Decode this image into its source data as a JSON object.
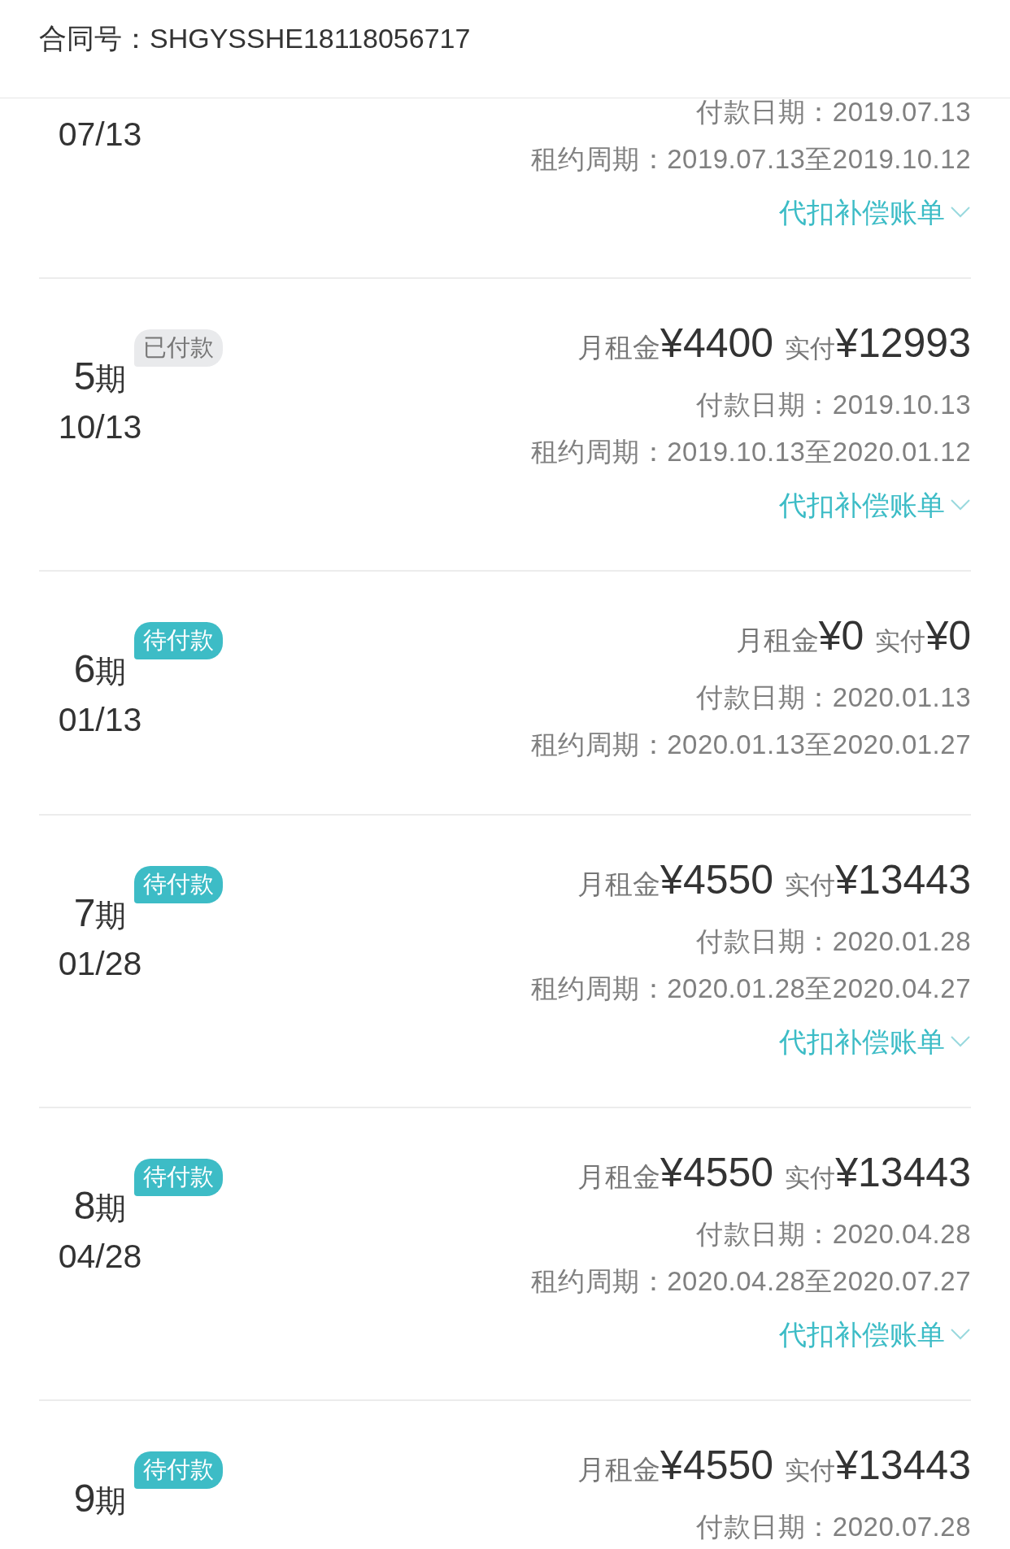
{
  "header": {
    "contract_label": "合同号：",
    "contract_no": "SHGYSSHE18118056717"
  },
  "installments": [
    {
      "date": "07/13",
      "pay_date": "付款日期：2019.07.13",
      "lease_period": "租约周期：2019.07.13至2019.10.12",
      "link": {
        "label": "代扣补偿账单",
        "expanded": false
      }
    },
    {
      "number": "5",
      "unit": "期",
      "status": {
        "label": "已付款",
        "kind": "paid"
      },
      "date": "10/13",
      "rent_label": "月租金",
      "rent": "¥4400",
      "paid_label": "实付",
      "paid": "¥12993",
      "pay_date": "付款日期：2019.10.13",
      "lease_period": "租约周期：2019.10.13至2020.01.12",
      "link": {
        "label": "代扣补偿账单",
        "expanded": false
      }
    },
    {
      "number": "6",
      "unit": "期",
      "status": {
        "label": "待付款",
        "kind": "pending"
      },
      "date": "01/13",
      "rent_label": "月租金",
      "rent": "¥0",
      "paid_label": "实付",
      "paid": "¥0",
      "pay_date": "付款日期：2020.01.13",
      "lease_period": "租约周期：2020.01.13至2020.01.27"
    },
    {
      "number": "7",
      "unit": "期",
      "status": {
        "label": "待付款",
        "kind": "pending"
      },
      "date": "01/28",
      "rent_label": "月租金",
      "rent": "¥4550",
      "paid_label": "实付",
      "paid": "¥13443",
      "pay_date": "付款日期：2020.01.28",
      "lease_period": "租约周期：2020.01.28至2020.04.27",
      "link": {
        "label": "代扣补偿账单",
        "expanded": false
      }
    },
    {
      "number": "8",
      "unit": "期",
      "status": {
        "label": "待付款",
        "kind": "pending"
      },
      "date": "04/28",
      "rent_label": "月租金",
      "rent": "¥4550",
      "paid_label": "实付",
      "paid": "¥13443",
      "pay_date": "付款日期：2020.04.28",
      "lease_period": "租约周期：2020.04.28至2020.07.27",
      "link": {
        "label": "代扣补偿账单",
        "expanded": false
      }
    },
    {
      "number": "9",
      "unit": "期",
      "status": {
        "label": "待付款",
        "kind": "pending"
      },
      "rent_label": "月租金",
      "rent": "¥4550",
      "paid_label": "实付",
      "paid": "¥13443",
      "pay_date": "付款日期：2020.07.28"
    }
  ]
}
